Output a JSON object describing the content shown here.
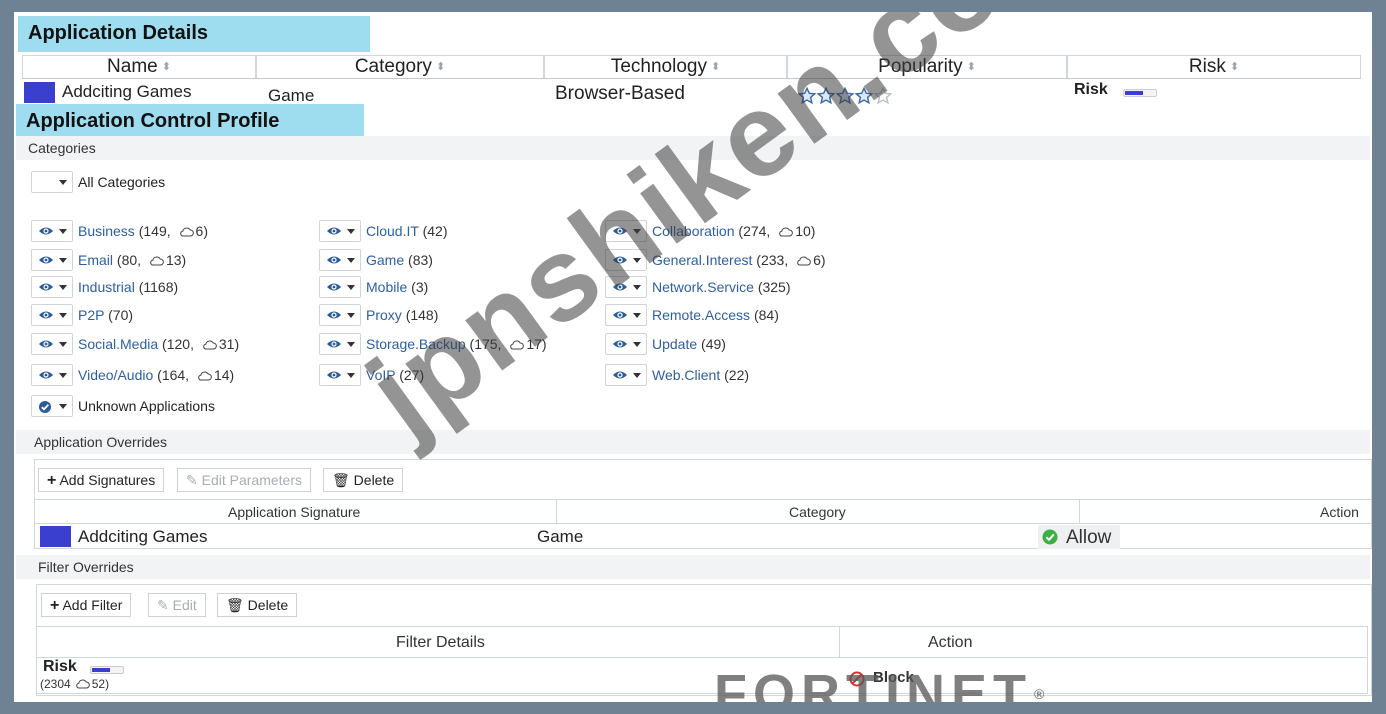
{
  "app_details": {
    "title": "Application Details",
    "headers": [
      "Name",
      "Category",
      "Technology",
      "Popularity",
      "Risk"
    ],
    "row": {
      "name": "Addciting Games",
      "category": "Game",
      "technology": "Browser-Based",
      "popularity_stars": 4,
      "popularity_max": 5,
      "risk_label": "Risk"
    },
    "app_color": "#3b3fcf"
  },
  "profile": {
    "title": "Application Control Profile",
    "categories_label": "Categories",
    "all_categories": "All Categories",
    "categories": [
      {
        "name": "Business",
        "count": "149",
        "cloud": "6"
      },
      {
        "name": "Cloud.IT",
        "count": "42"
      },
      {
        "name": "Collaboration",
        "count": "274",
        "cloud": "10"
      },
      {
        "name": "Email",
        "count": "80",
        "cloud": "13"
      },
      {
        "name": "Game",
        "count": "83"
      },
      {
        "name": "General.Interest",
        "count": "233",
        "cloud": "6"
      },
      {
        "name": "Industrial",
        "count": "1168"
      },
      {
        "name": "Mobile",
        "count": "3"
      },
      {
        "name": "Network.Service",
        "count": "325"
      },
      {
        "name": "P2P",
        "count": "70"
      },
      {
        "name": "Proxy",
        "count": "148"
      },
      {
        "name": "Remote.Access",
        "count": "84"
      },
      {
        "name": "Social.Media",
        "count": "120",
        "cloud": "31"
      },
      {
        "name": "Storage.Backup",
        "count": "175",
        "cloud": "17"
      },
      {
        "name": "Update",
        "count": "49"
      },
      {
        "name": "Video/Audio",
        "count": "164",
        "cloud": "14"
      },
      {
        "name": "VoIP",
        "count": "27"
      },
      {
        "name": "Web.Client",
        "count": "22"
      }
    ],
    "unknown_apps": "Unknown Applications",
    "app_overrides": {
      "label": "Application Overrides",
      "add": "Add Signatures",
      "edit": "Edit Parameters",
      "delete": "Delete",
      "headers": [
        "Application Signature",
        "Category",
        "Action"
      ],
      "row": {
        "name": "Addciting Games",
        "category": "Game",
        "action": "Allow"
      }
    },
    "filter_overrides": {
      "label": "Filter Overrides",
      "add": "Add Filter",
      "edit": "Edit",
      "delete": "Delete",
      "headers": [
        "Filter Details",
        "Action"
      ],
      "row": {
        "risk": "Risk",
        "count": "2304",
        "cloud": "52",
        "action": "Block"
      }
    }
  },
  "watermark": "jpnshiken.com",
  "brand": {
    "name": "FORTINET",
    "mark": "®"
  }
}
